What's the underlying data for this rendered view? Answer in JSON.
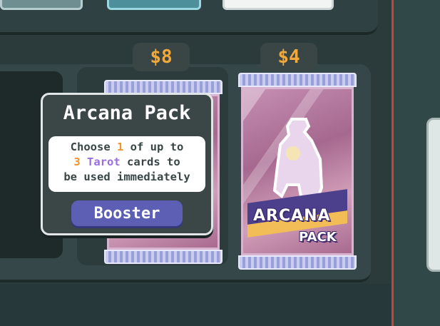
{
  "shop": {
    "items": [
      {
        "price": "$8"
      },
      {
        "price": "$4",
        "art_line1": "ARCANA",
        "art_line2": "PACK"
      }
    ]
  },
  "tooltip": {
    "title": "Arcana Pack",
    "desc_line1_pre": "Choose ",
    "desc_choose_count": "1",
    "desc_line1_post": " of up to",
    "desc_total_count": "3",
    "desc_card_type": "Tarot",
    "desc_line2_post": " cards to",
    "desc_line3": "be used immediately",
    "badge": "Booster"
  },
  "colors": {
    "price": "#f2a93b",
    "highlight_number": "#f0952d",
    "highlight_tarot": "#9a6ee0",
    "badge": "#5c5fb3"
  }
}
